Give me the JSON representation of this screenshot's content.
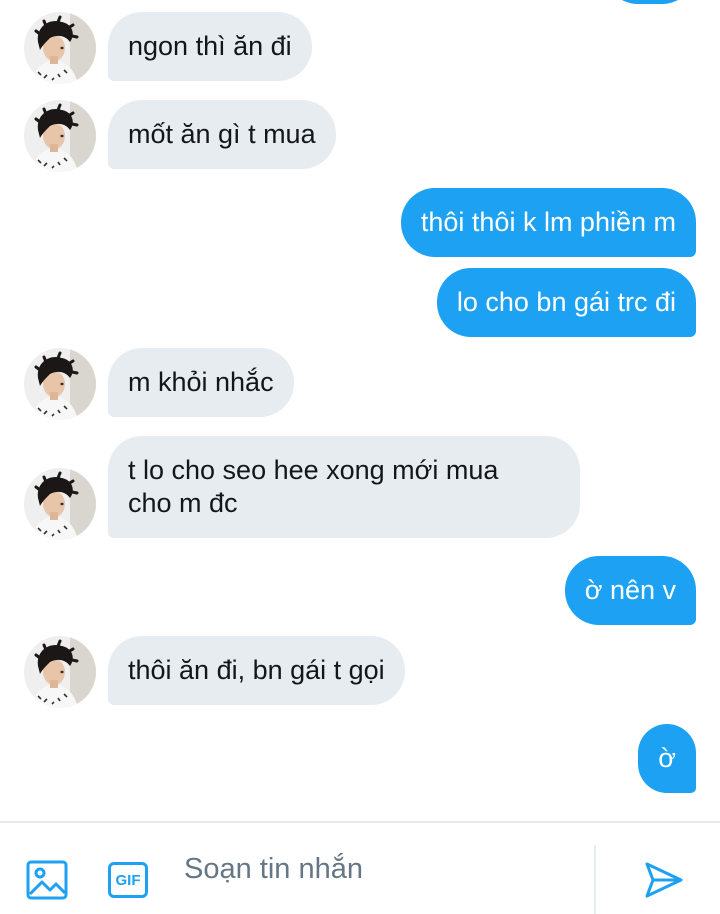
{
  "messages": [
    {
      "from": "them",
      "text": "ngon thì ăn đi"
    },
    {
      "from": "them",
      "text": "mốt ăn gì t mua"
    },
    {
      "from": "me",
      "text": "thôi thôi k lm phiền m"
    },
    {
      "from": "me",
      "text": "lo cho bn gái trc đi"
    },
    {
      "from": "them",
      "text": "m khỏi nhắc"
    },
    {
      "from": "them",
      "text": "t lo cho seo hee xong mới mua\ncho m đc"
    },
    {
      "from": "me",
      "text": "ờ nên v"
    },
    {
      "from": "them",
      "text": "thôi ăn đi, bn gái t gọi"
    },
    {
      "from": "me",
      "text": "ờ"
    }
  ],
  "composer": {
    "placeholder": "Soạn tin nhắn",
    "gif_label": "GIF",
    "icons": [
      "image-icon",
      "gif-icon",
      "send-icon"
    ]
  },
  "colors": {
    "accent": "#1da1f2",
    "incoming_bubble": "#e6ecf0",
    "incoming_text": "#14171a",
    "outgoing_text": "#ffffff",
    "placeholder": "#657786"
  }
}
